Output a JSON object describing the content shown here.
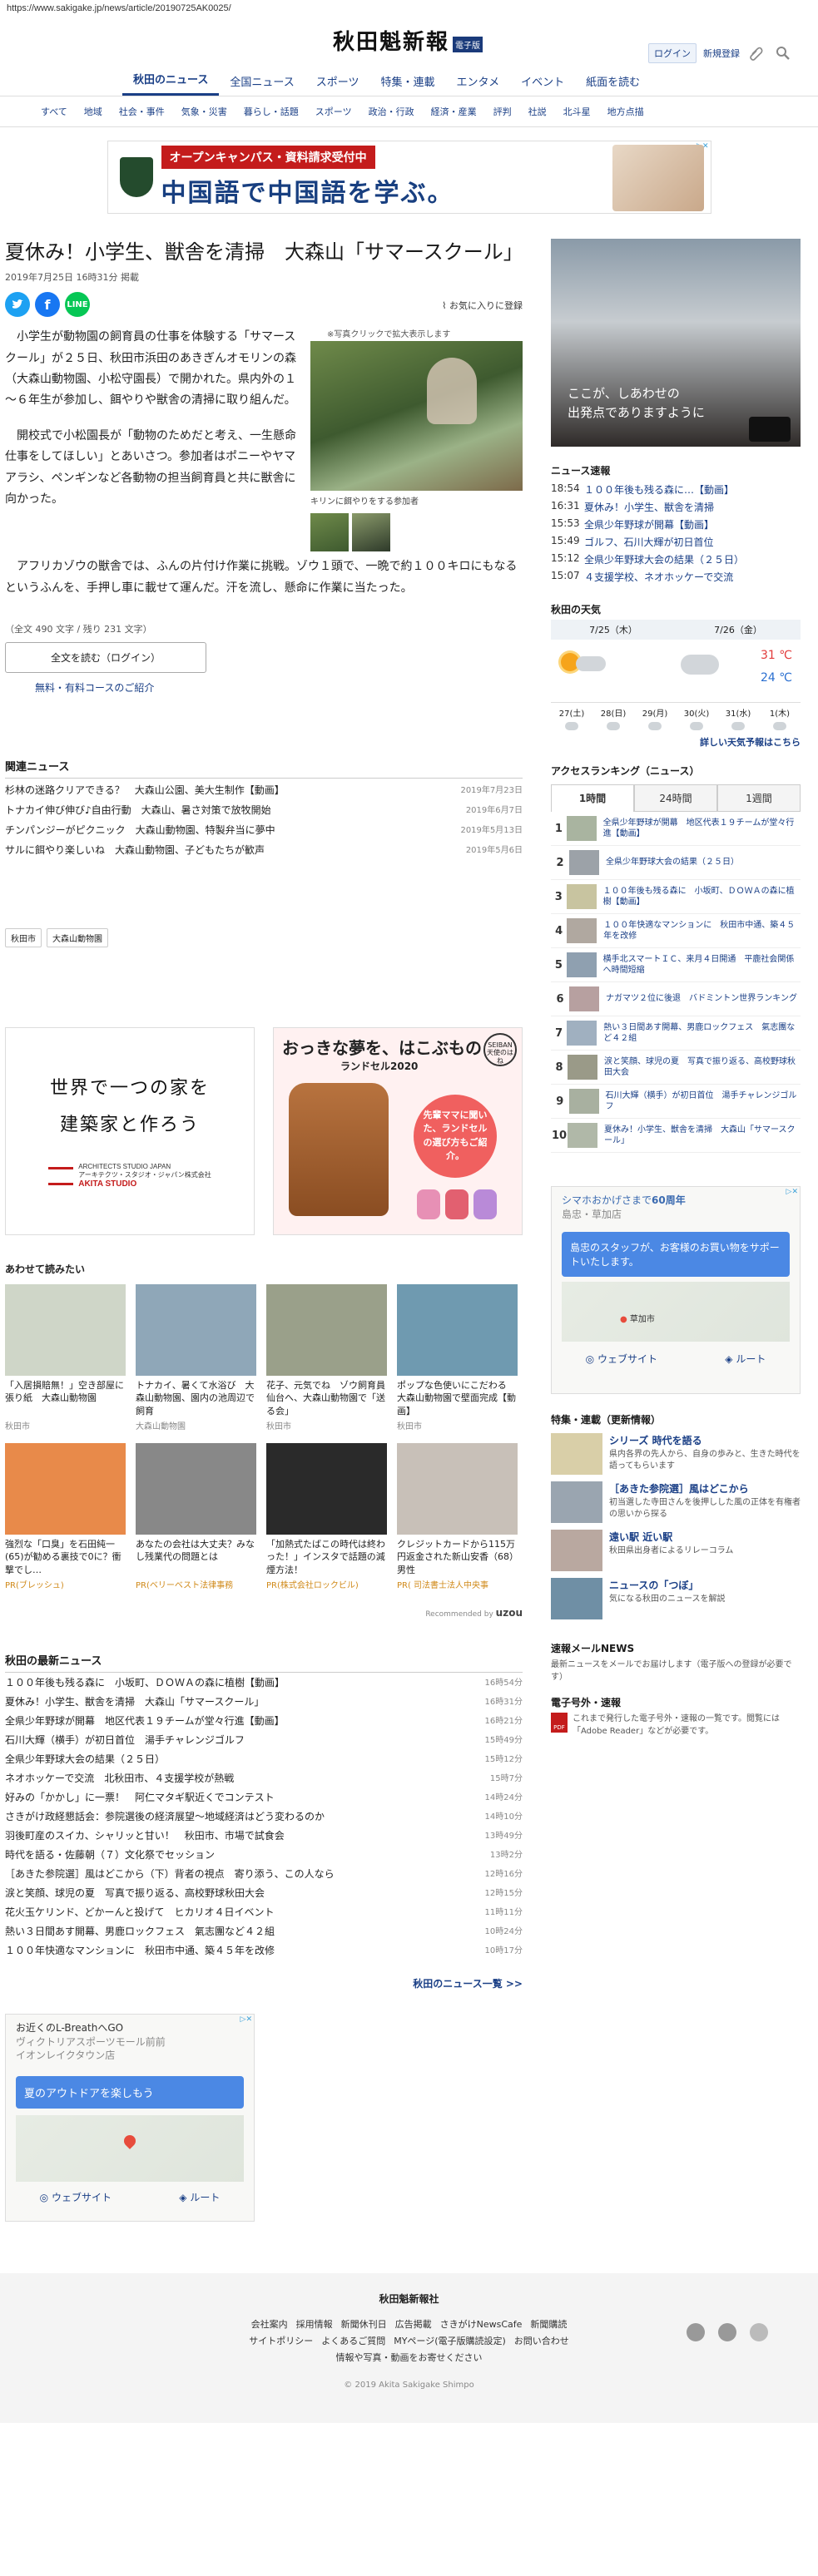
{
  "url": "https://www.sakigake.jp/news/article/20190725AK0025/",
  "site": {
    "logo_text": "秋田魁新報",
    "logo_badge": "電子版",
    "login": "ログイン",
    "register": "新規登録"
  },
  "main_nav": [
    "秋田のニュース",
    "全国ニュース",
    "スポーツ",
    "特集・連載",
    "エンタメ",
    "イベント",
    "紙面を読む"
  ],
  "sub_nav": [
    "すべて",
    "地域",
    "社会・事件",
    "気象・災害",
    "暮らし・話題",
    "スポーツ",
    "政治・行政",
    "経済・産業",
    "評判",
    "社説",
    "北斗星",
    "地方点描"
  ],
  "top_ad": {
    "red": "オープンキャンパス・資料請求受付中",
    "big": "中国語で中国語を学ぶ。"
  },
  "article": {
    "title": "夏休み！小学生、獣舎を清掃　大森山「サマースクール」",
    "date": "2019年7月25日 16時31分 掲載",
    "fav": "お気に入りに登録",
    "fig_note": "※写真クリックで拡大表示します",
    "fig_caption": "キリンに餌やりをする参加者",
    "p1": "小学生が動物園の飼育員の仕事を体験する「サマースクール」が２５日、秋田市浜田のあきぎんオモリンの森（大森山動物園、小松守園長）で開かれた。県内外の１～６年生が参加し、餌やりや獣舎の清掃に取り組んだ。",
    "p2": "開校式で小松園長が「動物のためだと考え、一生懸命仕事をしてほしい」とあいさつ。参加者はポニーやヤマアラシ、ペンギンなど各動物の担当飼育員と共に獣舎に向かった。",
    "p3": "アフリカゾウの獣舎では、ふんの片付け作業に挑戦。ゾウ１頭で、一晩で約１００キロにもなるというふんを、手押し車に載せて運んだ。汗を流し、懸命に作業に当たった。",
    "char_count": "（全文 490 文字 / 残り 231 文字）",
    "full_btn": "全文を読む（ログイン）",
    "free_link": "無料・有料コースのご紹介"
  },
  "related": {
    "title": "関連ニュース",
    "items": [
      {
        "text": "杉林の迷路クリアできる？　大森山公園、美大生制作【動画】",
        "date": "2019年7月23日"
      },
      {
        "text": "トナカイ伸び伸び♪自由行動　大森山、暑さ対策で放牧開始",
        "date": "2019年6月7日"
      },
      {
        "text": "チンパンジーがピクニック　大森山動物園、特製弁当に夢中",
        "date": "2019年5月13日"
      },
      {
        "text": "サルに餌やり楽しいね　大森山動物園、子どもたちが歓声",
        "date": "2019年5月6日"
      }
    ]
  },
  "tags": [
    "秋田市",
    "大森山動物園"
  ],
  "ad_house": {
    "l1": "世界で一つの家を",
    "l2": "建築家と作ろう",
    "brand1": "ARCHITECTS STUDIO JAPAN",
    "brand2": "アーキテクツ・スタジオ・ジャパン株式会社",
    "brand3": "AKITA STUDIO"
  },
  "ad_bag": {
    "t1": "おっきな夢を、はこぶもの",
    "t2": "ランドセル2020",
    "bubble": "先輩ママに聞いた、ランドセルの選び方もご紹介。",
    "badge": "SEIBAN 天使のはね"
  },
  "recommend": {
    "title": "あわせて読みたい",
    "by": "Recommended by",
    "by_brand": "uzou",
    "cards": [
      {
        "cap": "「入居損賠無！」空き部屋に張り紙　大森山動物園",
        "src": "秋田市",
        "pr": false,
        "c": "#cfd6c8"
      },
      {
        "cap": "トナカイ、暑くて水浴び　大森山動物園、園内の池周辺で飼育",
        "src": "大森山動物園",
        "pr": false,
        "c": "#8fa7b8"
      },
      {
        "cap": "花子、元気でね　ゾウ飼育員仙台へ、大森山動物園で「送る会」",
        "src": "秋田市",
        "pr": false,
        "c": "#9aa08a"
      },
      {
        "cap": "ポップな色使いにこだわる　大森山動物園で壁面完成【動画】",
        "src": "秋田市",
        "pr": false,
        "c": "#6f9ab0"
      },
      {
        "cap": "強烈な「口臭」を石田純一(65)が勧める裏技で0に？衝撃でし…",
        "src": "PR(ブレッシュ)",
        "pr": true,
        "c": "#e88a4a"
      },
      {
        "cap": "あなたの会社は大丈夫？みなし残業代の問題とは",
        "src": "PR(ベリーベスト法律事務",
        "pr": true,
        "c": "#888888"
      },
      {
        "cap": "「加熱式たばこの時代は終わった！」インスタで話題の減煙方法！",
        "src": "PR(株式会社ロックビル)",
        "pr": true,
        "c": "#2a2a2a"
      },
      {
        "cap": "クレジットカードから115万円返金された新山安香（68）男性",
        "src": "PR( 司法書士法人中央事",
        "pr": true,
        "c": "#c8c0b8"
      }
    ]
  },
  "latest": {
    "title": "秋田の最新ニュース",
    "more": "秋田のニュース一覧 >>",
    "items": [
      {
        "text": "１００年後も残る森に　小坂町、ＤＯＷＡの森に植樹【動画】",
        "date": "16時54分"
      },
      {
        "text": "夏休み！小学生、獣舎を清掃　大森山「サマースクール」",
        "date": "16時31分"
      },
      {
        "text": "全県少年野球が開幕　地区代表１９チームが堂々行進【動画】",
        "date": "16時21分"
      },
      {
        "text": "石川大輝（横手）が初日首位　湯手チャレンジゴルフ",
        "date": "15時49分"
      },
      {
        "text": "全県少年野球大会の結果（２５日）",
        "date": "15時12分"
      },
      {
        "text": "ネオホッケーで交流　北秋田市、４支援学校が熱戦",
        "date": "15時7分"
      },
      {
        "text": "好みの「かかし」に一票！　阿仁マタギ駅近くでコンテスト",
        "date": "14時24分"
      },
      {
        "text": "さきがけ政経懇話会：参院選後の経済展望～地域経済はどう変わるのか",
        "date": "14時10分"
      },
      {
        "text": "羽後町産のスイカ、シャリッと甘い！　秋田市、市場で試食会",
        "date": "13時49分"
      },
      {
        "text": "時代を語る・佐藤朝（７）文化祭でセッション",
        "date": "13時2分"
      },
      {
        "text": "［あきた参院選］風はどこから（下）背者の視点　寄り添う、この人なら",
        "date": "12時16分"
      },
      {
        "text": "涙と笑顔、球児の夏　写真で振り返る、高校野球秋田大会",
        "date": "12時15分"
      },
      {
        "text": "花火玉ケリンド、どかーんと投げて　ヒカリオ４日イベント",
        "date": "11時11分"
      },
      {
        "text": "熱い３日間あす開幕、男鹿ロックフェス　氣志團など４２組",
        "date": "10時24分"
      },
      {
        "text": "１００年快適なマンションに　秋田市中通、築４５年を改修",
        "date": "10時17分"
      }
    ]
  },
  "map_ad": {
    "h1": "お近くのL-Breath",
    "h1b": "へGO",
    "h2": "ヴィクトリアスポーツモール前前",
    "h3": "イオンレイクタウン店",
    "blue": "夏のアウトドアを楽しもう",
    "b1": "ウェブサイト",
    "b2": "ルート"
  },
  "right": {
    "photo_text1": "ここが、しあわせの",
    "photo_text2": "出発点でありますように",
    "flash_title": "ニュース速報",
    "flash": [
      {
        "t": "18:54",
        "x": "１００年後も残る森に…【動画】"
      },
      {
        "t": "16:31",
        "x": "夏休み！小学生、獣舎を清掃"
      },
      {
        "t": "15:53",
        "x": "全県少年野球が開幕【動画】"
      },
      {
        "t": "15:49",
        "x": "ゴルフ、石川大輝が初日首位"
      },
      {
        "t": "15:12",
        "x": "全県少年野球大会の結果（２５日）"
      },
      {
        "t": "15:07",
        "x": "４支援学校、ネオホッケーで交流"
      }
    ],
    "weather_title": "秋田の天気",
    "wx_d1": "7/25（木）",
    "wx_d2": "7/26（金）",
    "wx_hi": "31 ℃",
    "wx_lo": "24 ℃",
    "wx_days": [
      "27(土)",
      "28(日)",
      "29(月)",
      "30(火)",
      "31(水)",
      "1(木)"
    ],
    "wx_more": "詳しい天気予報はこちら",
    "rank_title": "アクセスランキング（ニュース）",
    "rank_tabs": [
      "1時間",
      "24時間",
      "1週間"
    ],
    "rank": [
      "全県少年野球が開幕　地区代表１９チームが堂々行進【動画】",
      "全県少年野球大会の結果（２５日）",
      "１００年後も残る森に　小坂町、ＤＯＷＡの森に植樹【動画】",
      "１００年快適なマンションに　秋田市中通、築４５年を改修",
      "横手北スマートＩＣ、来月４日開通　平鹿社会関係へ時間短縮",
      "ナガマツ２位に後退　バドミントン世界ランキング",
      "熱い３日間あす開幕、男鹿ロックフェス　氣志團など４２組",
      "涙と笑顔、球児の夏　写真で振り返る、高校野球秋田大会",
      "石川大輝（横手）が初日首位　湯手チャレンジゴルフ",
      "夏休み！小学生、獣舎を清掃　大森山「サマースクール」"
    ],
    "ad2_h1": "シマホおかげさまで",
    "ad2_h1b": "60周年",
    "ad2_h2": "島忠・草加店",
    "ad2_blue": "島忠のスタッフが、お客様のお買い物をサポートいたします。",
    "ad2_pin": "草加市",
    "feature_title": "特集・連載（更新情報）",
    "features": [
      {
        "h": "シリーズ 時代を語る",
        "p": "県内各界の先人から、自身の歩みと、生きた時代を語ってもらいます",
        "c": "#d9cfa8"
      },
      {
        "h": "［あきた参院選］風はどこから",
        "p": "初当選した寺田さんを後押しした風の正体を有権者の思いから探る",
        "c": "#9aa5b0"
      },
      {
        "h": "遠い駅 近い駅",
        "p": "秋田県出身者によるリレーコラム",
        "c": "#b9a8a0"
      },
      {
        "h": "ニュースの「つぼ」",
        "p": "気になる秋田のニュースを解説",
        "c": "#6f8fa5"
      }
    ],
    "mail_title": "速報メールNEWS",
    "mail_text": "最新ニュースをメールでお届けします（電子版への登録が必要です）",
    "pdf_title": "電子号外・速報",
    "pdf_text": "これまで発行した電子号外・速報の一覧です。閲覧には「Adobe Reader」などが必要です。",
    "pdf_icon": "PDF"
  },
  "footer": {
    "name": "秋田魁新報社",
    "links": [
      "会社案内",
      "採用情報",
      "新聞休刊日",
      "広告掲載",
      "さきがけNewsCafe",
      "新聞購読",
      "サイトポリシー",
      "よくあるご質問",
      "MYページ(電子版購読設定)",
      "お問い合わせ",
      "情報や写真・動画をお寄せください"
    ],
    "copy": "© 2019 Akita Sakigake Shimpo"
  },
  "colors": {
    "accent": "#1a3f86",
    "red": "#c41c1c"
  }
}
